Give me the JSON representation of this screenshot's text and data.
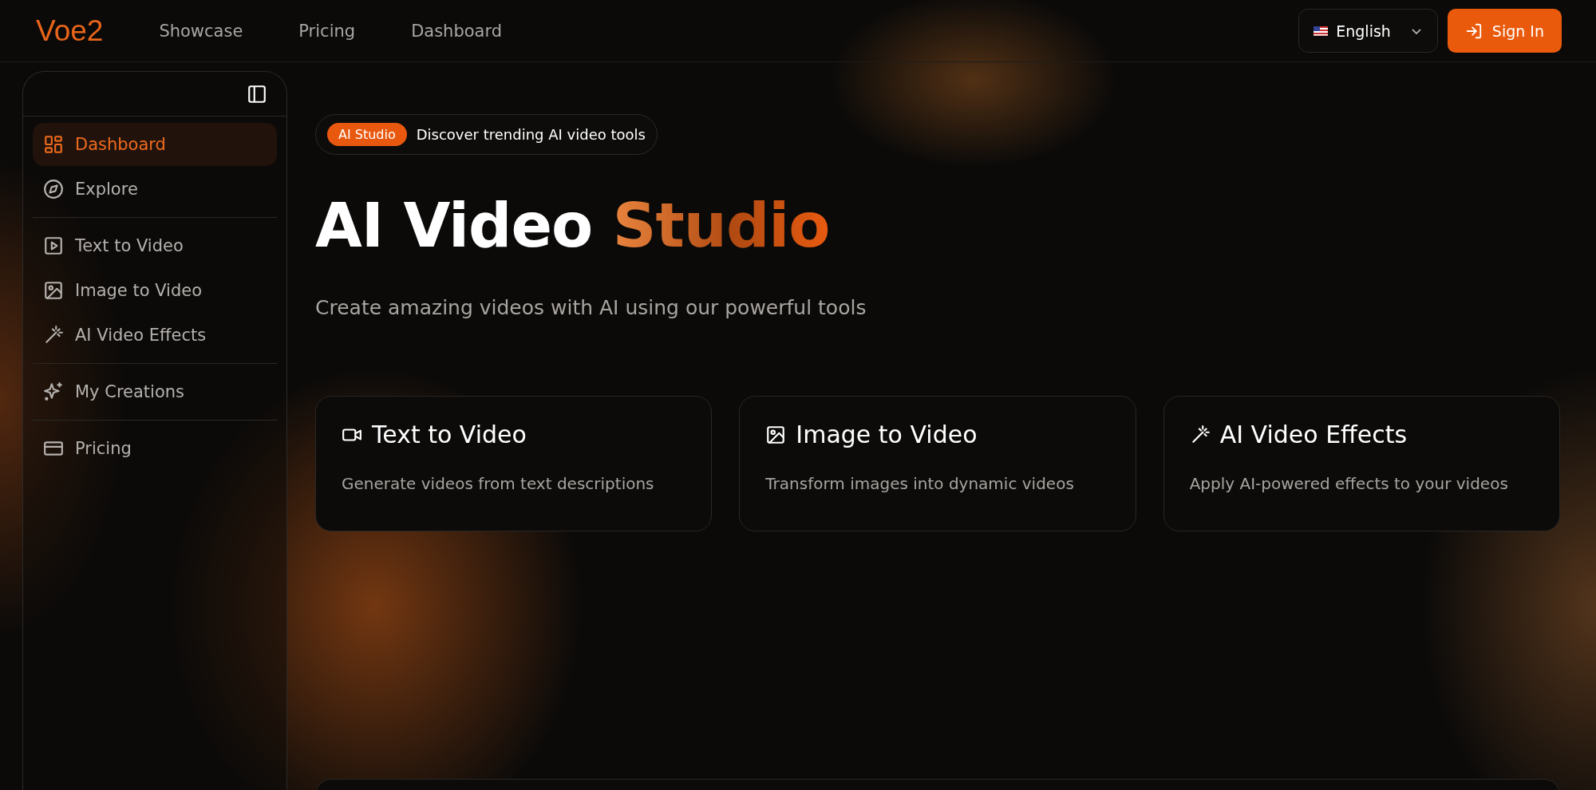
{
  "header": {
    "logo": "Voe2",
    "nav": [
      {
        "label": "Showcase"
      },
      {
        "label": "Pricing"
      },
      {
        "label": "Dashboard"
      }
    ],
    "language": {
      "label": "English"
    },
    "sign_in": "Sign In"
  },
  "sidebar": {
    "sections": [
      {
        "items": [
          {
            "label": "Dashboard",
            "selected": true
          },
          {
            "label": "Explore",
            "selected": false
          }
        ]
      },
      {
        "items": [
          {
            "label": "Text to Video",
            "selected": false
          },
          {
            "label": "Image to Video",
            "selected": false
          },
          {
            "label": "AI Video Effects",
            "selected": false
          }
        ]
      },
      {
        "items": [
          {
            "label": "My Creations",
            "selected": false
          }
        ]
      },
      {
        "items": [
          {
            "label": "Pricing",
            "selected": false
          }
        ]
      }
    ]
  },
  "hero": {
    "badge": "AI Studio",
    "badge_text": "Discover trending AI video tools",
    "title": "AI Video",
    "title_accent": "Studio",
    "subtitle": "Create amazing videos with AI using our powerful tools"
  },
  "cards": [
    {
      "title": "Text to Video",
      "description": "Generate videos from text descriptions"
    },
    {
      "title": "Image to Video",
      "description": "Transform images into dynamic videos"
    },
    {
      "title": "AI Video Effects",
      "description": "Apply AI-powered effects to your videos"
    }
  ]
}
